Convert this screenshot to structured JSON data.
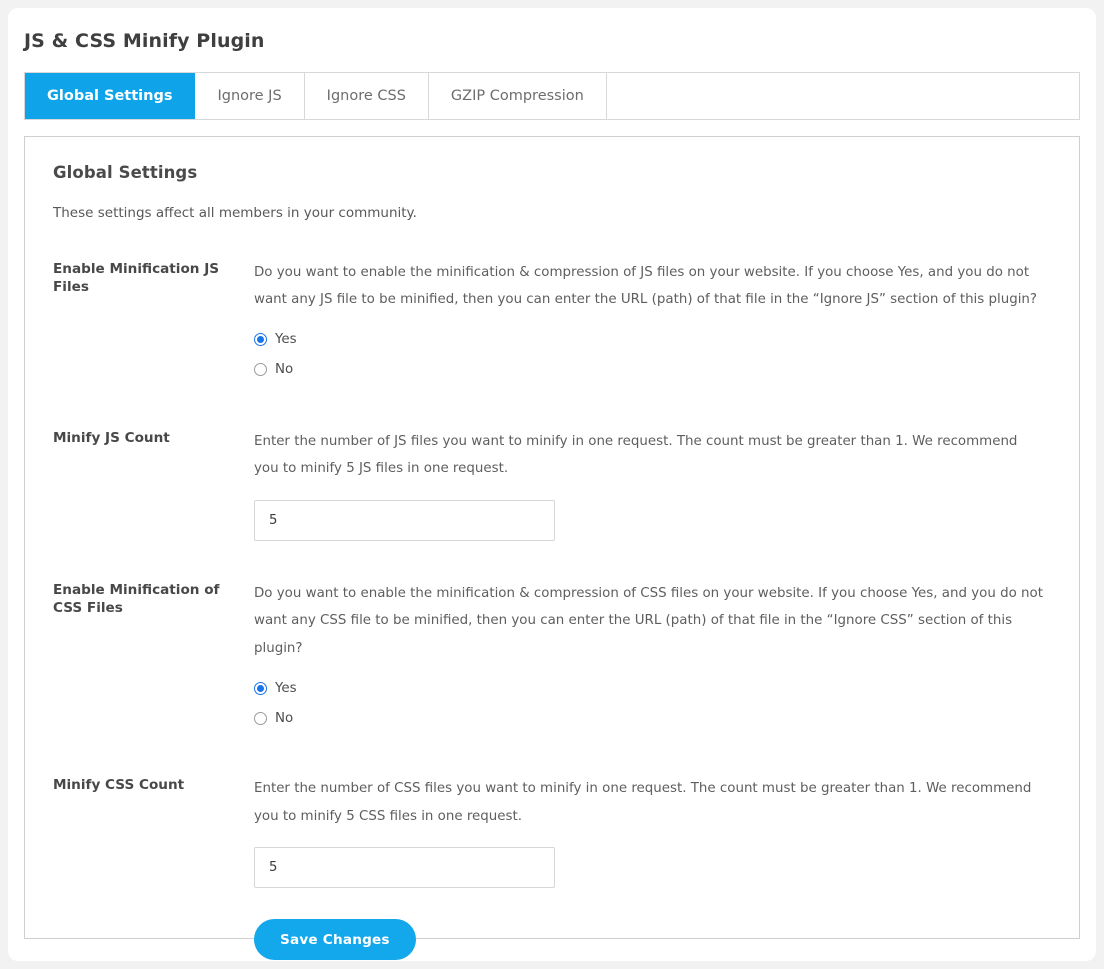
{
  "page": {
    "title": "JS & CSS Minify Plugin",
    "accent_color": "#0fa4e9",
    "button_color": "#13a7ec",
    "radio_checked_color": "#1a73e8"
  },
  "tabs": [
    {
      "label": "Global Settings",
      "active": true
    },
    {
      "label": "Ignore JS",
      "active": false
    },
    {
      "label": "Ignore CSS",
      "active": false
    },
    {
      "label": "GZIP Compression",
      "active": false
    }
  ],
  "panel": {
    "heading": "Global Settings",
    "subheading": "These settings affect all members in your community."
  },
  "settings": {
    "enable_js": {
      "label": "Enable Minification JS Files",
      "description": "Do you want to enable the minification & compression of JS files on your website. If you choose Yes, and you do not want any JS file to be minified, then you can enter the URL (path) of that file in the “Ignore JS” section of this plugin?",
      "options": [
        {
          "label": "Yes",
          "checked": true
        },
        {
          "label": "No",
          "checked": false
        }
      ]
    },
    "minify_js_count": {
      "label": "Minify JS Count",
      "description": "Enter the number of JS files you want to minify in one request. The count must be greater than 1. We recommend you to minify 5 JS files in one request.",
      "value": "5"
    },
    "enable_css": {
      "label": "Enable Minification of CSS Files",
      "description": "Do you want to enable the minification & compression of CSS files on your website. If you choose Yes, and you do not want any CSS file to be minified, then you can enter the URL (path) of that file in the “Ignore CSS” section of this plugin?",
      "options": [
        {
          "label": "Yes",
          "checked": true
        },
        {
          "label": "No",
          "checked": false
        }
      ]
    },
    "minify_css_count": {
      "label": "Minify CSS Count",
      "description": "Enter the number of CSS files you want to minify in one request. The count must be greater than 1. We recommend you to minify 5 CSS files in one request.",
      "value": "5"
    }
  },
  "actions": {
    "save_label": "Save Changes"
  }
}
